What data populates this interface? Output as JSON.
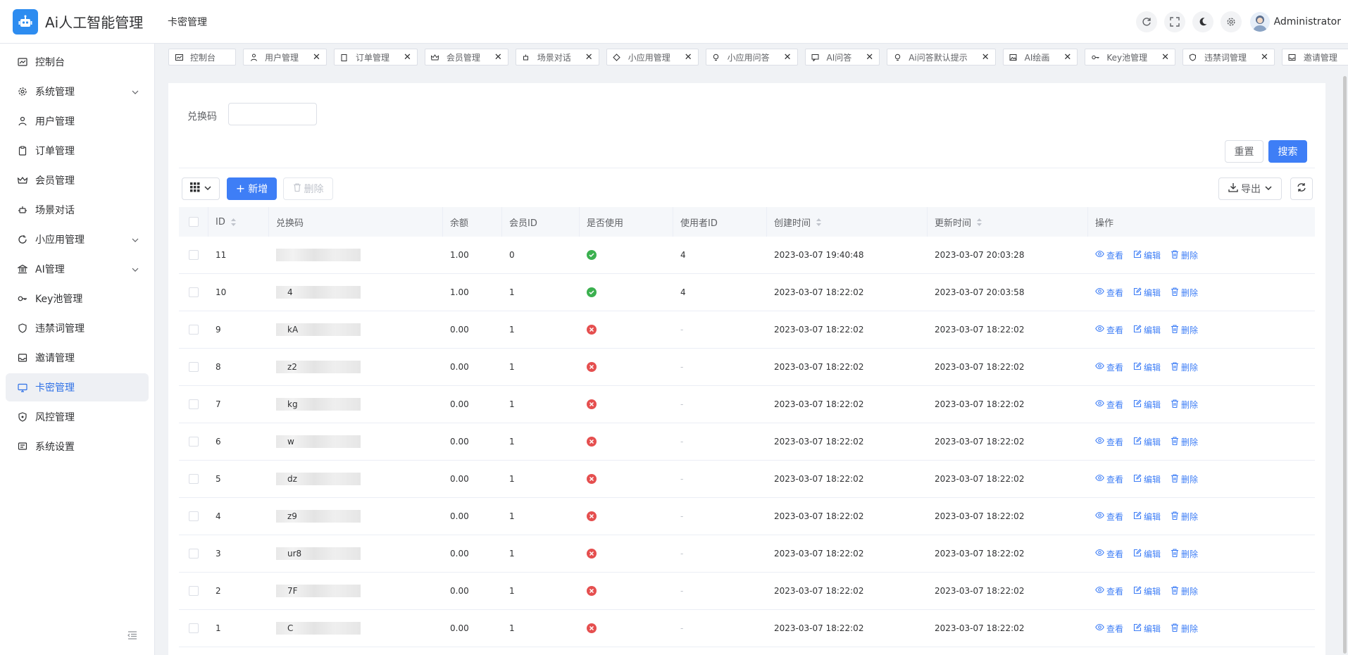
{
  "app": {
    "title": "Ai人工智能管理",
    "breadcrumb": "卡密管理"
  },
  "header": {
    "user_name": "Administrator",
    "tools": [
      "refresh-icon",
      "fullscreen-icon",
      "moon-icon",
      "gear-icon"
    ]
  },
  "colors": {
    "primary": "#3e7ef6",
    "success": "#3bb04f",
    "danger": "#e54f4f",
    "active_bg": "#eef0f4"
  },
  "sidebar": {
    "items": [
      {
        "label": "控制台",
        "icon": "dashboard-icon",
        "expandable": false,
        "active": false
      },
      {
        "label": "系统管理",
        "icon": "gear-icon",
        "expandable": true,
        "active": false
      },
      {
        "label": "用户管理",
        "icon": "user-icon",
        "expandable": false,
        "active": false
      },
      {
        "label": "订单管理",
        "icon": "clipboard-icon",
        "expandable": false,
        "active": false
      },
      {
        "label": "会员管理",
        "icon": "crown-icon",
        "expandable": false,
        "active": false
      },
      {
        "label": "场景对话",
        "icon": "robot-icon",
        "expandable": false,
        "active": false
      },
      {
        "label": "小应用管理",
        "icon": "refresh-icon",
        "expandable": true,
        "active": false
      },
      {
        "label": "AI管理",
        "icon": "bank-icon",
        "expandable": true,
        "active": false
      },
      {
        "label": "Key池管理",
        "icon": "key-icon",
        "expandable": false,
        "active": false
      },
      {
        "label": "违禁词管理",
        "icon": "shield-icon",
        "expandable": false,
        "active": false
      },
      {
        "label": "邀请管理",
        "icon": "inbox-icon",
        "expandable": false,
        "active": false
      },
      {
        "label": "卡密管理",
        "icon": "card-icon",
        "expandable": false,
        "active": true
      },
      {
        "label": "风控管理",
        "icon": "shield-check-icon",
        "expandable": false,
        "active": false
      },
      {
        "label": "系统设置",
        "icon": "message-icon",
        "expandable": false,
        "active": false
      }
    ]
  },
  "tabs": [
    {
      "label": "控制台",
      "icon": "dashboard-icon",
      "closable": false
    },
    {
      "label": "用户管理",
      "icon": "user-icon",
      "closable": true
    },
    {
      "label": "订单管理",
      "icon": "clipboard-icon",
      "closable": true
    },
    {
      "label": "会员管理",
      "icon": "crown-icon",
      "closable": true
    },
    {
      "label": "场景对话",
      "icon": "robot-icon",
      "closable": true
    },
    {
      "label": "小应用管理",
      "icon": "apps-icon",
      "closable": true
    },
    {
      "label": "小应用问答",
      "icon": "bulb-icon",
      "closable": true
    },
    {
      "label": "AI问答",
      "icon": "chat-icon",
      "closable": true
    },
    {
      "label": "Ai问答默认提示",
      "icon": "bulb-icon",
      "closable": true
    },
    {
      "label": "AI绘画",
      "icon": "picture-icon",
      "closable": true
    },
    {
      "label": "Key池管理",
      "icon": "key-icon",
      "closable": true
    },
    {
      "label": "违禁词管理",
      "icon": "shield-icon",
      "closable": true
    },
    {
      "label": "邀请管理",
      "icon": "inbox-icon",
      "closable": true
    }
  ],
  "search": {
    "label": "兑换码",
    "value": "",
    "placeholder": ""
  },
  "buttons": {
    "reset": "重置",
    "search": "搜索",
    "add": "新增",
    "delete": "删除",
    "export": "导出"
  },
  "table": {
    "columns": [
      "ID",
      "兑换码",
      "余额",
      "会员ID",
      "是否使用",
      "使用者ID",
      "创建时间",
      "更新时间",
      "操作"
    ],
    "actions": [
      "查看",
      "编辑",
      "删除"
    ],
    "rows": [
      {
        "id": "11",
        "code_fragment": "",
        "balance": "1.00",
        "member_id": "0",
        "used": true,
        "user_id": "4",
        "created": "2023-03-07 19:40:48",
        "updated": "2023-03-07 20:03:28"
      },
      {
        "id": "10",
        "code_fragment": "4",
        "balance": "1.00",
        "member_id": "1",
        "used": true,
        "user_id": "4",
        "created": "2023-03-07 18:22:02",
        "updated": "2023-03-07 20:03:58"
      },
      {
        "id": "9",
        "code_fragment": "kA",
        "balance": "0.00",
        "member_id": "1",
        "used": false,
        "user_id": "-",
        "created": "2023-03-07 18:22:02",
        "updated": "2023-03-07 18:22:02"
      },
      {
        "id": "8",
        "code_fragment": "z2",
        "balance": "0.00",
        "member_id": "1",
        "used": false,
        "user_id": "-",
        "created": "2023-03-07 18:22:02",
        "updated": "2023-03-07 18:22:02"
      },
      {
        "id": "7",
        "code_fragment": "kg",
        "balance": "0.00",
        "member_id": "1",
        "used": false,
        "user_id": "-",
        "created": "2023-03-07 18:22:02",
        "updated": "2023-03-07 18:22:02"
      },
      {
        "id": "6",
        "code_fragment": "w",
        "balance": "0.00",
        "member_id": "1",
        "used": false,
        "user_id": "-",
        "created": "2023-03-07 18:22:02",
        "updated": "2023-03-07 18:22:02"
      },
      {
        "id": "5",
        "code_fragment": "dz",
        "balance": "0.00",
        "member_id": "1",
        "used": false,
        "user_id": "-",
        "created": "2023-03-07 18:22:02",
        "updated": "2023-03-07 18:22:02"
      },
      {
        "id": "4",
        "code_fragment": "z9",
        "balance": "0.00",
        "member_id": "1",
        "used": false,
        "user_id": "-",
        "created": "2023-03-07 18:22:02",
        "updated": "2023-03-07 18:22:02"
      },
      {
        "id": "3",
        "code_fragment": "ur8",
        "balance": "0.00",
        "member_id": "1",
        "used": false,
        "user_id": "-",
        "created": "2023-03-07 18:22:02",
        "updated": "2023-03-07 18:22:02"
      },
      {
        "id": "2",
        "code_fragment": "7F",
        "balance": "0.00",
        "member_id": "1",
        "used": false,
        "user_id": "-",
        "created": "2023-03-07 18:22:02",
        "updated": "2023-03-07 18:22:02"
      },
      {
        "id": "1",
        "code_fragment": "C",
        "balance": "0.00",
        "member_id": "1",
        "used": false,
        "user_id": "-",
        "created": "2023-03-07 18:22:02",
        "updated": "2023-03-07 18:22:02"
      }
    ]
  }
}
